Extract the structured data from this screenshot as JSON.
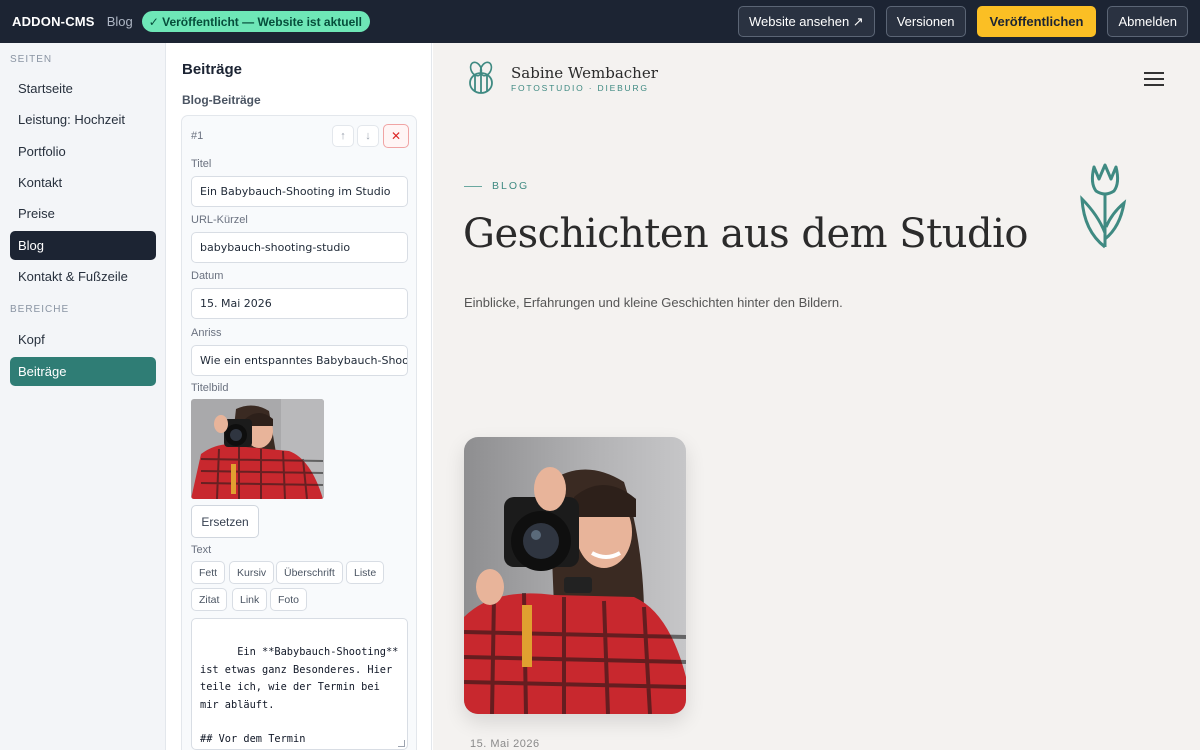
{
  "topbar": {
    "brand": "ADDON-CMS",
    "crumb": "Blog",
    "status": "✓ Veröffentlicht — Website ist aktuell",
    "buttons": {
      "view_site": "Website ansehen ↗",
      "versions": "Versionen",
      "publish": "Veröffentlichen",
      "logout": "Abmelden"
    },
    "colors": {
      "bar": "#1c2433",
      "publish": "#fbbf24",
      "status_bg": "#6ee7b7"
    }
  },
  "nav": {
    "section_pages": "SEITEN",
    "pages": [
      "Startseite",
      "Leistung: Hochzeit",
      "Portfolio",
      "Kontakt",
      "Preise",
      "Blog",
      "Kontakt & Fußzeile"
    ],
    "active_page": "Blog",
    "section_areas": "BEREICHE",
    "areas": [
      "Kopf",
      "Beiträge"
    ],
    "active_area": "Beiträge"
  },
  "editor": {
    "title": "Beiträge",
    "subtitle": "Blog-Beiträge",
    "entry": {
      "number": "#1",
      "title_label": "Titel",
      "title_value": "Ein Babybauch-Shooting im Studio",
      "slug_label": "URL-Kürzel",
      "slug_value": "babybauch-shooting-studio",
      "date_label": "Datum",
      "date_value": "15. Mai 2026",
      "teaser_label": "Anriss",
      "teaser_value": "Wie ein entspanntes Babybauch-Shooting bei mir abläuft",
      "image_label": "Titelbild",
      "replace_button": "Ersetzen",
      "text_label": "Text",
      "format_buttons": [
        "Fett",
        "Kursiv",
        "Überschrift",
        "Liste",
        "Zitat",
        "Link",
        "Foto"
      ],
      "text_value": "Ein **Babybauch-Shooting** ist etwas ganz Besonderes. Hier teile ich, wie der Termin bei mir abläuft.\n\n## Vor dem Termin"
    }
  },
  "preview": {
    "logo_name": "Sabine Wembacher",
    "logo_sub": "FOTOSTUDIO · DIEBURG",
    "eyebrow": "BLOG",
    "headline": "Geschichten aus dem Studio",
    "intro": "Einblicke, Erfahrungen und kleine Geschichten hinter den Bildern.",
    "post_date": "15. Mai 2026",
    "colors": {
      "accent": "#3f8a82",
      "background": "#f4f2f0"
    }
  }
}
